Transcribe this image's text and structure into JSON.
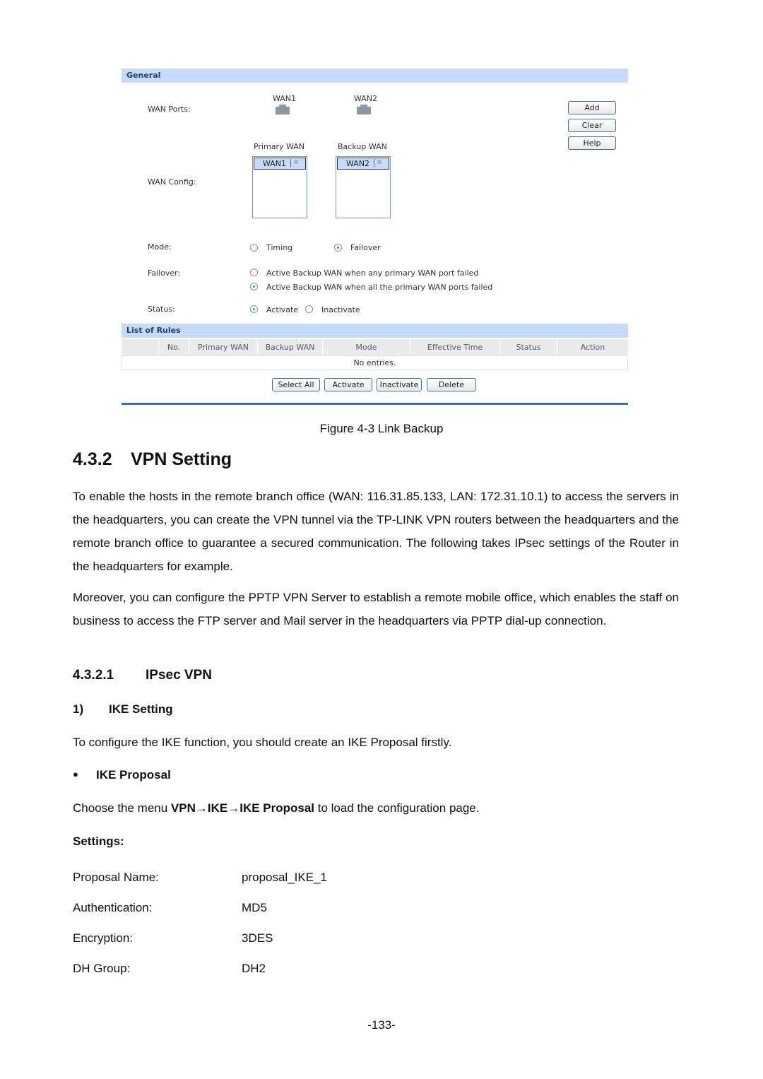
{
  "figure": {
    "general_title": "General",
    "wan_ports_label": "WAN Ports:",
    "ports": [
      {
        "name": "WAN1"
      },
      {
        "name": "WAN2"
      }
    ],
    "buttons": {
      "add": "Add",
      "clear": "Clear",
      "help": "Help"
    },
    "primary_wan_header": "Primary WAN",
    "backup_wan_header": "Backup WAN",
    "wan_config_label": "WAN Config:",
    "primary_wan_value": "WAN1",
    "backup_wan_value": "WAN2",
    "remove_icon": "✕",
    "mode": {
      "label": "Mode:",
      "options": [
        "Timing",
        "Failover"
      ],
      "selected": "Failover"
    },
    "failover": {
      "label": "Failover:",
      "options": [
        "Active Backup WAN when any primary WAN port failed",
        "Active Backup WAN when all the primary WAN ports failed"
      ],
      "selected": 1
    },
    "status": {
      "label": "Status:",
      "options": [
        "Activate",
        "Inactivate"
      ],
      "selected": "Activate"
    },
    "rules_title": "List of Rules",
    "table": {
      "columns": [
        "",
        "No.",
        "Primary WAN",
        "Backup WAN",
        "Mode",
        "Effective Time",
        "Status",
        "Action"
      ],
      "empty_text": "No entries."
    },
    "actions": {
      "select_all": "Select All",
      "activate": "Activate",
      "inactivate": "Inactivate",
      "delete": "Delete"
    }
  },
  "caption": "Figure 4-3 Link Backup",
  "section": {
    "number": "4.3.2",
    "title": "VPN Setting"
  },
  "paragraphs": [
    "To enable the hosts in the remote branch office (WAN: 116.31.85.133, LAN: 172.31.10.1) to access the servers in the headquarters, you can create the VPN tunnel via the TP-LINK VPN routers between the headquarters and the remote branch office to guarantee a secured communication. The following takes IPsec settings of the Router in the headquarters for example.",
    "Moreover, you can configure the PPTP VPN Server to establish a remote mobile office, which enables the staff on business to access the FTP server and Mail server in the headquarters via PPTP dial-up connection."
  ],
  "subsection": {
    "number": "4.3.2.1",
    "title": "IPsec VPN"
  },
  "step": {
    "number": "1)",
    "title": "IKE Setting"
  },
  "step_text": "To configure the IKE function, you should create an IKE Proposal firstly.",
  "bullet": {
    "symbol": "●",
    "title": "IKE Proposal"
  },
  "menu_path": {
    "prefix": "Choose the menu ",
    "path": "VPN→IKE→IKE Proposal",
    "suffix": " to load the configuration page."
  },
  "settings_label": "Settings:",
  "settings": [
    {
      "key": "Proposal Name:",
      "value": "proposal_IKE_1"
    },
    {
      "key": "Authentication:",
      "value": "MD5"
    },
    {
      "key": "Encryption:",
      "value": "3DES"
    },
    {
      "key": "DH Group:",
      "value": "DH2"
    }
  ],
  "page_number": "-133-"
}
